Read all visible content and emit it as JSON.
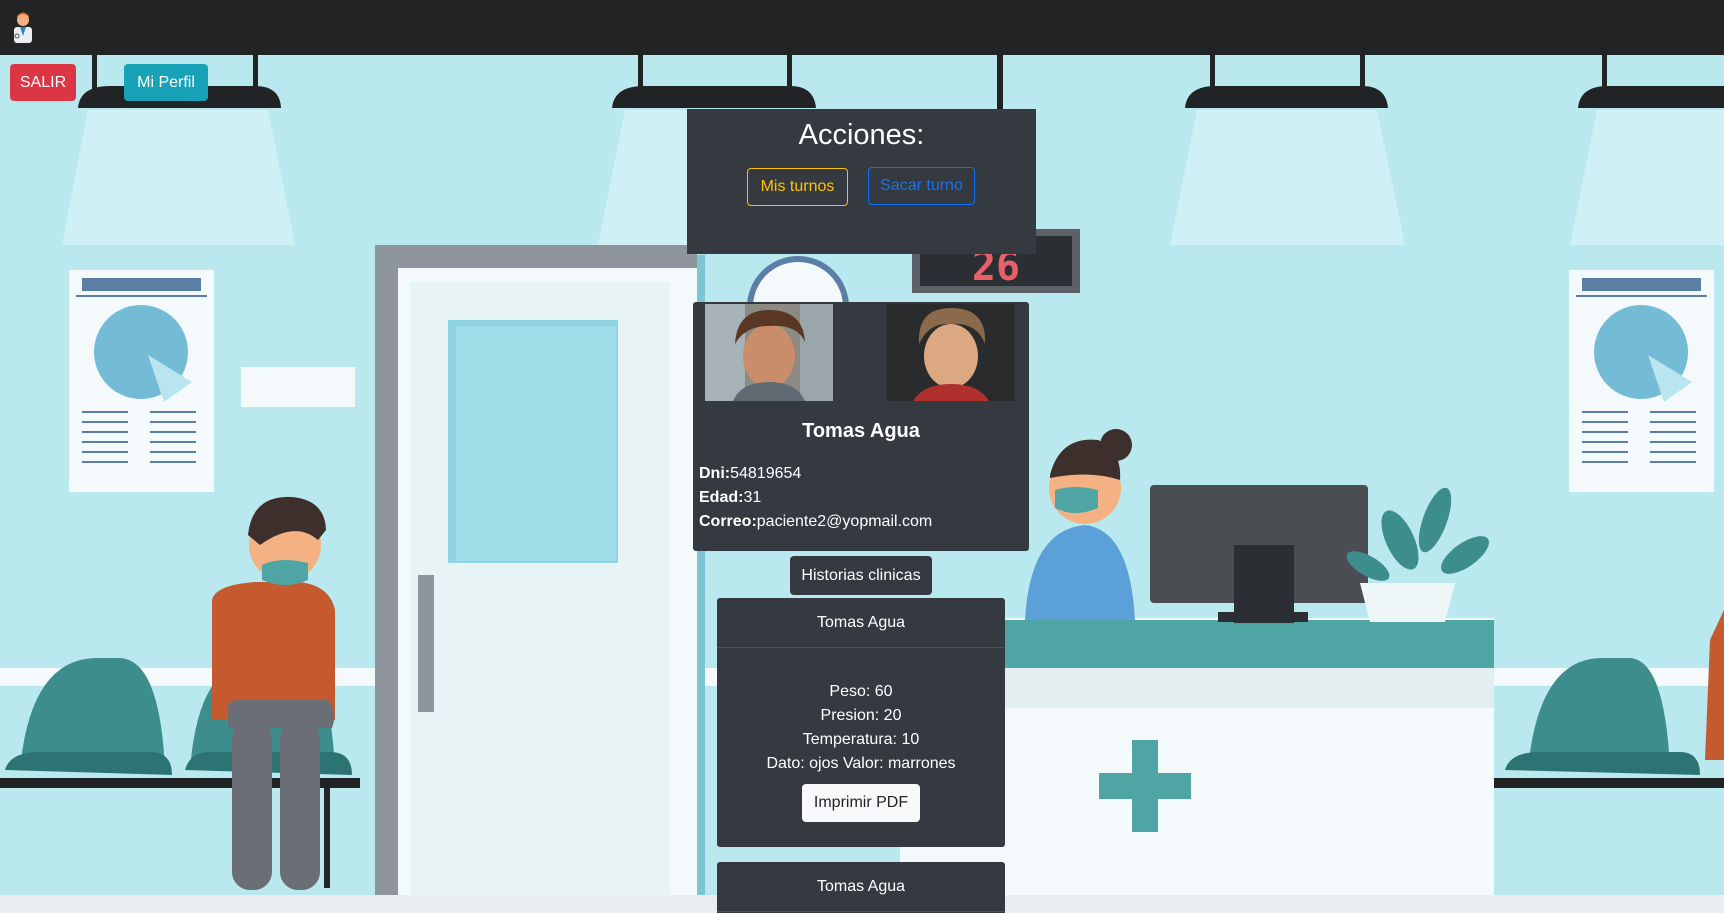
{
  "navbar": {
    "logo_icon": "doctor-avatar-icon"
  },
  "top_buttons": {
    "salir": "SALIR",
    "mi_perfil": "Mi Perfil"
  },
  "acciones": {
    "title": "Acciones:",
    "mis_turnos": "Mis turnos",
    "sacar_turno": "Sacar turno"
  },
  "scene": {
    "ticket_number": "26"
  },
  "profile": {
    "name": "Tomas Agua",
    "dni_label": "Dni:",
    "dni": "54819654",
    "edad_label": "Edad:",
    "edad": "31",
    "correo_label": "Correo:",
    "correo": "paciente2@yopmail.com"
  },
  "historias": {
    "button": "Historias clinicas",
    "cards": [
      {
        "name": "Tomas Agua",
        "peso": "Peso: 60",
        "presion": "Presion: 20",
        "temperatura": "Temperatura: 10",
        "dato": "Dato: ojos Valor: marrones",
        "pdf_button": "Imprimir PDF"
      },
      {
        "name": "Tomas Agua"
      }
    ]
  },
  "colors": {
    "navbar": "#222325",
    "danger": "#dc3545",
    "info": "#17a2b8",
    "dark_panel": "#343a40",
    "warning": "#ffc107",
    "primary": "#0d6efd",
    "wall": "#b9e9ee"
  }
}
